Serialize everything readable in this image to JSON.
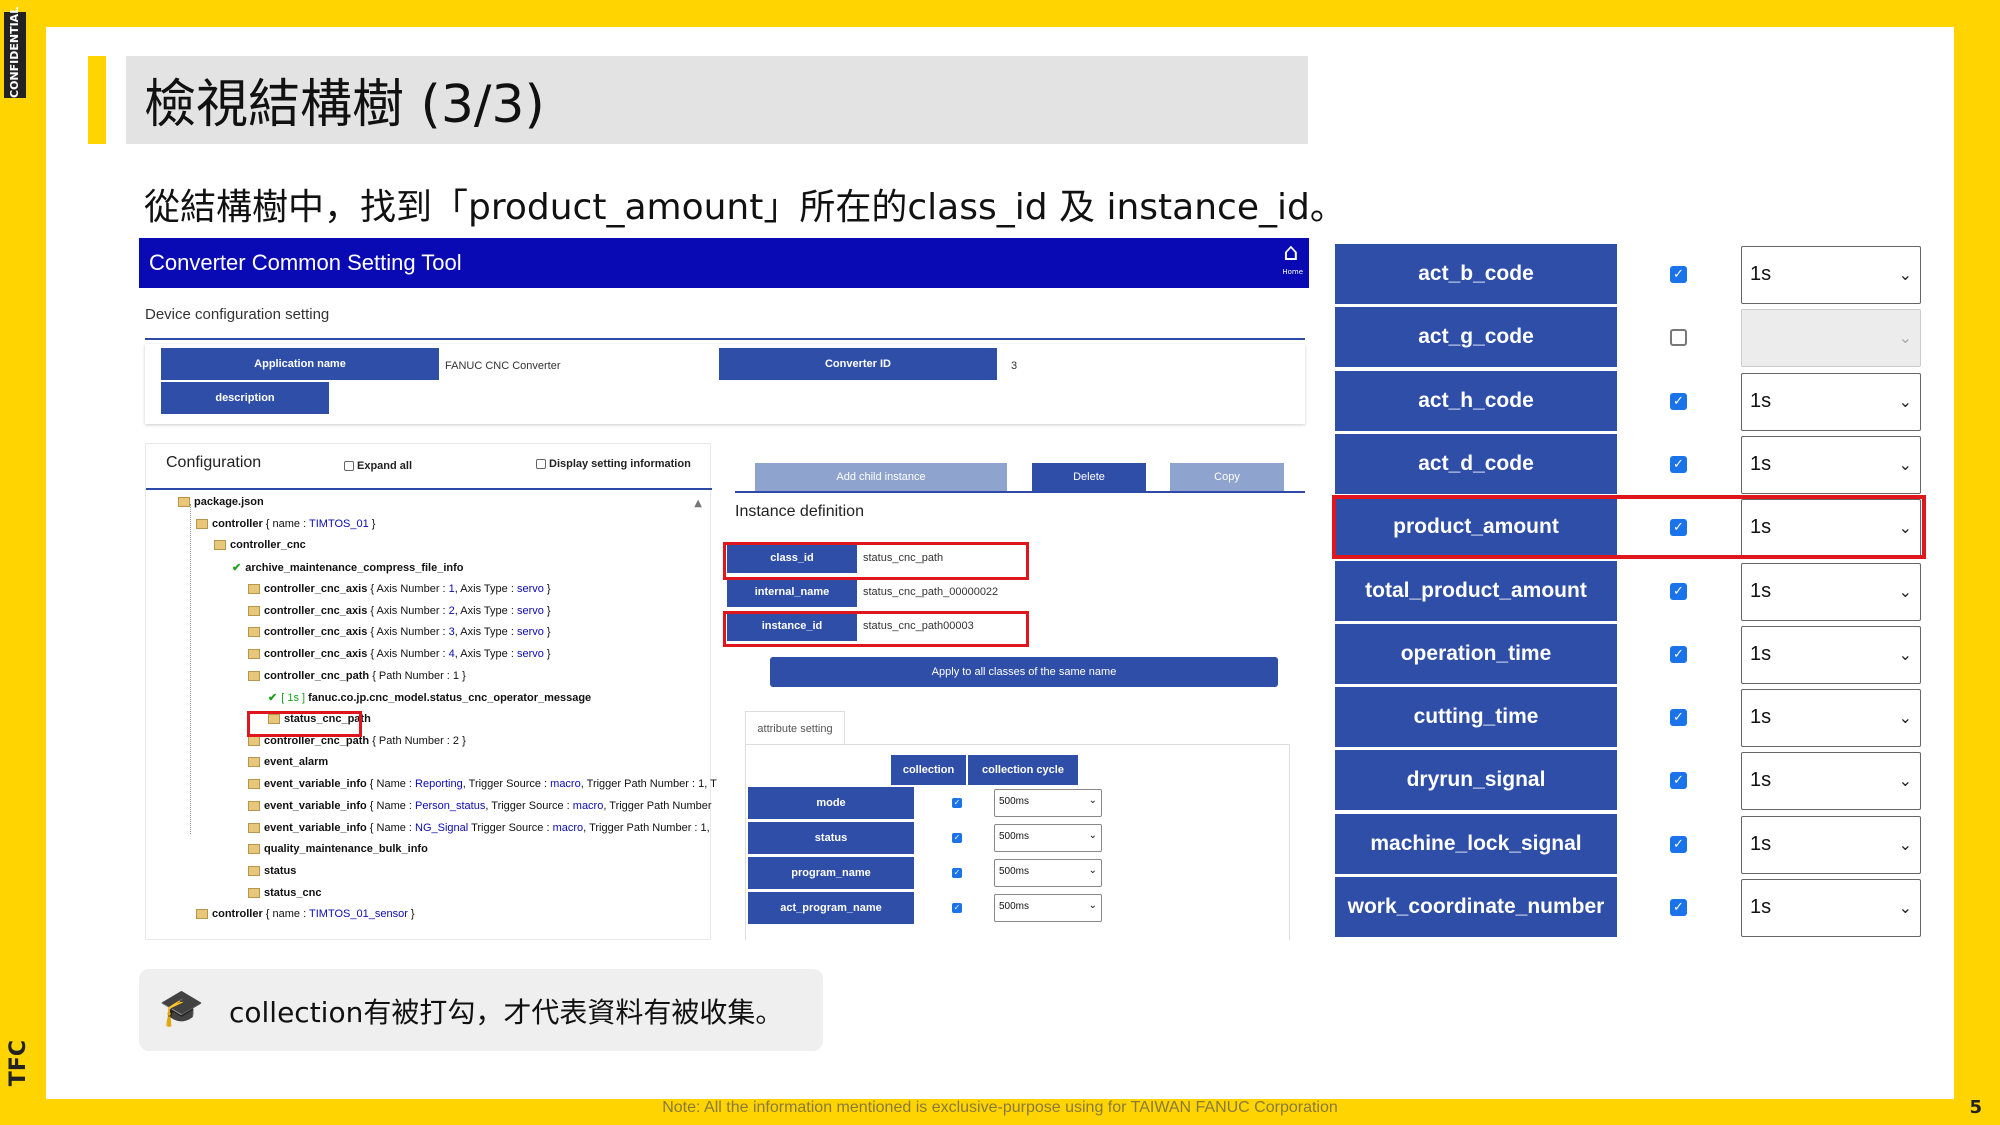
{
  "slide": {
    "title": "檢視結構樹 (3/3)",
    "subtitle": "從結構樹中，找到「product_amount」所在的class_id 及 instance_id。",
    "confidential": "CONFIDENTIAL",
    "brand": "TFC",
    "page_number": "5",
    "footer_note": "Note: All the information mentioned is exclusive-purpose using for TAIWAN FANUC Corporation",
    "note": "collection有被打勾，才代表資料有被收集。",
    "note_icon": "graduation-cap-icon"
  },
  "app": {
    "title": "Converter Common Setting Tool",
    "home_label": "Home",
    "device_config_label": "Device configuration setting",
    "application_name_label": "Application name",
    "application_name_value": "FANUC CNC Converter",
    "converter_id_label": "Converter ID",
    "converter_id_value": "3",
    "description_label": "description",
    "configuration_title": "Configuration",
    "expand_all": "Expand all",
    "display_setting": "Display setting information",
    "tree": [
      {
        "name": "package.json",
        "extra": "",
        "hl": ""
      },
      {
        "name": "controller",
        "extra": " { name : ",
        "hl": "TIMTOS_01",
        "tail": " }"
      },
      {
        "name": "controller_cnc",
        "extra": "",
        "hl": ""
      },
      {
        "name": "archive_maintenance_compress_file_info",
        "extra": "",
        "hl": ""
      },
      {
        "name": "controller_cnc_axis",
        "extra": " { Axis Number : ",
        "hl": "1",
        "tail": ", Axis Type : ",
        "hl2": "servo",
        "tail2": " }"
      },
      {
        "name": "controller_cnc_axis",
        "extra": " { Axis Number : ",
        "hl": "2",
        "tail": ", Axis Type : ",
        "hl2": "servo",
        "tail2": " }"
      },
      {
        "name": "controller_cnc_axis",
        "extra": " { Axis Number : ",
        "hl": "3",
        "tail": ", Axis Type : ",
        "hl2": "servo",
        "tail2": " }"
      },
      {
        "name": "controller_cnc_axis",
        "extra": " { Axis Number : ",
        "hl": "4",
        "tail": ", Axis Type : ",
        "hl2": "servo",
        "tail2": " }"
      },
      {
        "name": "controller_cnc_path",
        "extra": " { Path Number : 1 }",
        "hl": ""
      },
      {
        "name": "fanuc.co.jp.cnc_model.status_cnc_operator_message",
        "extra": "",
        "hl": "",
        "prefix": "[ 1s ] "
      },
      {
        "name": "status_cnc_path",
        "extra": "",
        "hl": ""
      },
      {
        "name": "controller_cnc_path",
        "extra": " { Path Number : 2 }",
        "hl": ""
      },
      {
        "name": "event_alarm",
        "extra": "",
        "hl": ""
      },
      {
        "name": "event_variable_info",
        "extra": " { Name : ",
        "hl": "Reporting",
        "tail": ", Trigger Source : ",
        "hl2": "macro",
        "tail2": ", Trigger Path Number : 1, T"
      },
      {
        "name": "event_variable_info",
        "extra": " { Name : ",
        "hl": "Person_status",
        "tail": ", Trigger Source : ",
        "hl2": "macro",
        "tail2": ", Trigger Path Number"
      },
      {
        "name": "event_variable_info",
        "extra": " { Name : ",
        "hl": "NG_Signal",
        "tail": "  Trigger Source : ",
        "hl2": "macro",
        "tail2": ", Trigger Path Number : 1,"
      },
      {
        "name": "quality_maintenance_bulk_info",
        "extra": "",
        "hl": ""
      },
      {
        "name": "status",
        "extra": "",
        "hl": ""
      },
      {
        "name": "status_cnc",
        "extra": "",
        "hl": ""
      },
      {
        "name": "controller",
        "extra": " { name : ",
        "hl": "TIMTOS_01_sensor",
        "tail": " }"
      }
    ],
    "buttons": {
      "add_child": "Add child instance",
      "delete": "Delete",
      "copy": "Copy",
      "apply_all": "Apply to all classes of the same name"
    },
    "instance_title": "Instance definition",
    "instance": [
      {
        "label": "class_id",
        "value": "status_cnc_path"
      },
      {
        "label": "internal_name",
        "value": "status_cnc_path_00000022"
      },
      {
        "label": "instance_id",
        "value": "status_cnc_path00003"
      }
    ],
    "attr_tab": "attribute setting",
    "col_collection": "collection",
    "col_cycle": "collection cycle",
    "attrs": [
      {
        "name": "mode",
        "cycle": "500ms"
      },
      {
        "name": "status",
        "cycle": "500ms"
      },
      {
        "name": "program_name",
        "cycle": "500ms"
      },
      {
        "name": "act_program_name",
        "cycle": "500ms"
      }
    ]
  },
  "right_table": [
    {
      "name": "act_b_code",
      "checked": true,
      "cycle": "1s"
    },
    {
      "name": "act_g_code",
      "checked": false,
      "cycle": ""
    },
    {
      "name": "act_h_code",
      "checked": true,
      "cycle": "1s"
    },
    {
      "name": "act_d_code",
      "checked": true,
      "cycle": "1s"
    },
    {
      "name": "product_amount",
      "checked": true,
      "cycle": "1s"
    },
    {
      "name": "total_product_amount",
      "checked": true,
      "cycle": "1s"
    },
    {
      "name": "operation_time",
      "checked": true,
      "cycle": "1s"
    },
    {
      "name": "cutting_time",
      "checked": true,
      "cycle": "1s"
    },
    {
      "name": "dryrun_signal",
      "checked": true,
      "cycle": "1s"
    },
    {
      "name": "machine_lock_signal",
      "checked": true,
      "cycle": "1s"
    },
    {
      "name": "work_coordinate_number",
      "checked": true,
      "cycle": "1s"
    }
  ],
  "colors": {
    "brand_yellow": "#ffd400",
    "header_blue": "#0a0ab4",
    "label_blue": "#2f4ea8",
    "highlight_red": "#e0161e"
  }
}
